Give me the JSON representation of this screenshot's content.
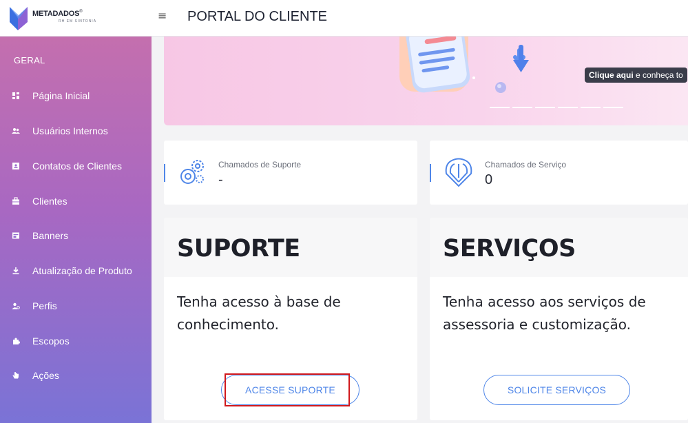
{
  "header": {
    "logo_name": "METADADOS",
    "logo_tm": "®",
    "logo_tagline": "RH EM SINTONIA",
    "title": "PORTAL DO CLIENTE",
    "menu_icon": "hamburger-icon"
  },
  "sidebar": {
    "section": "GERAL",
    "items": [
      {
        "label": "Página Inicial",
        "icon": "dashboard-icon"
      },
      {
        "label": "Usuários Internos",
        "icon": "users-icon"
      },
      {
        "label": "Contatos de Clientes",
        "icon": "contact-card-icon"
      },
      {
        "label": "Clientes",
        "icon": "briefcase-icon"
      },
      {
        "label": "Banners",
        "icon": "banner-icon"
      },
      {
        "label": "Atualização de Produto",
        "icon": "download-icon"
      },
      {
        "label": "Perfis",
        "icon": "profile-icon"
      },
      {
        "label": "Escopos",
        "icon": "puzzle-icon"
      },
      {
        "label": "Ações",
        "icon": "hand-icon"
      }
    ]
  },
  "banner": {
    "cta_bold": "Clique aqui",
    "cta_rest": " e conheça to"
  },
  "stats": [
    {
      "label": "Chamados de Suporte",
      "value": "-",
      "icon": "gears-icon"
    },
    {
      "label": "Chamados de Serviço",
      "value": "0",
      "icon": "shield-tools-icon"
    }
  ],
  "cards": [
    {
      "title": "SUPORTE",
      "line1": "Tenha acesso à base de",
      "line2": "conhecimento.",
      "button": "ACESSE SUPORTE"
    },
    {
      "title": "SERVIÇOS",
      "line1": "Tenha acesso aos serviços de",
      "line2": "assessoria e customização.",
      "button": "SOLICITE SERVIÇOS"
    }
  ],
  "colors": {
    "accent": "#4f86e8",
    "highlight": "#d0181c",
    "sidebar_top": "#c46fae",
    "sidebar_bottom": "#7a73d6"
  }
}
